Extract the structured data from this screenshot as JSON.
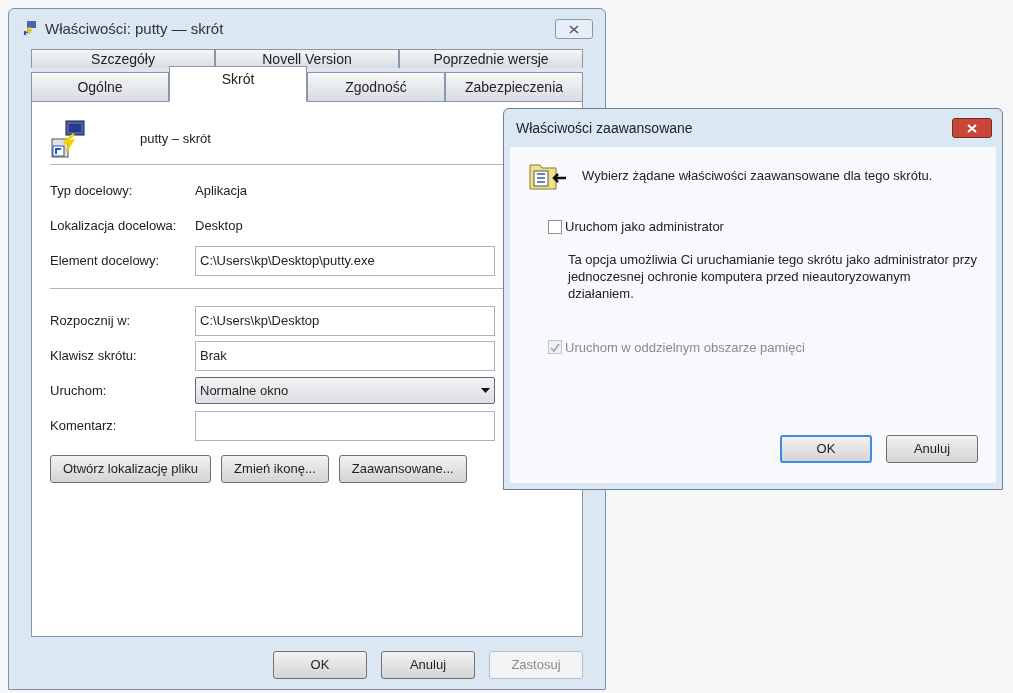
{
  "main_window": {
    "title": "Właściwości: putty — skrót",
    "tab_rows": [
      [
        {
          "label": "Szczegóły",
          "selected": false
        },
        {
          "label": "Novell Version",
          "selected": false
        },
        {
          "label": "Poprzednie wersje",
          "selected": false
        }
      ],
      [
        {
          "label": "Ogólne",
          "selected": false
        },
        {
          "label": "Skrót",
          "selected": true
        },
        {
          "label": "Zgodność",
          "selected": false
        },
        {
          "label": "Zabezpieczenia",
          "selected": false
        }
      ]
    ],
    "shortcut_name": "putty – skrót",
    "groups": [
      [
        {
          "kind": "static",
          "label": "Typ docelowy:",
          "value": "Aplikacja"
        },
        {
          "kind": "static",
          "label": "Lokalizacja docelowa:",
          "value": "Desktop"
        },
        {
          "kind": "input",
          "label": "Element docelowy:",
          "value": "C:\\Users\\kp\\Desktop\\putty.exe"
        }
      ],
      [
        {
          "kind": "input",
          "label": "Rozpocznij w:",
          "value": "C:\\Users\\kp\\Desktop"
        },
        {
          "kind": "input",
          "label": "Klawisz skrótu:",
          "value": "Brak"
        },
        {
          "kind": "dropdown",
          "label": "Uruchom:",
          "value": "Normalne okno"
        },
        {
          "kind": "input",
          "label": "Komentarz:"
        }
      ]
    ],
    "panel_buttons": [
      "Otwórz lokalizację pliku",
      "Zmień ikonę...",
      "Zaawansowane..."
    ],
    "footer_buttons": [
      {
        "label": "OK",
        "disabled": false
      },
      {
        "label": "Anuluj",
        "disabled": false
      },
      {
        "label": "Zastosuj",
        "disabled": true
      }
    ]
  },
  "advanced_dialog": {
    "title": "Właściwości zaawansowane",
    "header": "Wybierz żądane właściwości zaawansowane dla tego skrótu.",
    "options": [
      {
        "label": "Uruchom jako administrator",
        "checked": false,
        "disabled": false,
        "description": "Ta opcja umożliwia Ci uruchamianie tego skrótu jako administrator przy jednoczesnej ochronie komputera przed nieautoryzowanym działaniem."
      },
      {
        "label": "Uruchom w oddzielnym obszarze pamięci",
        "checked": true,
        "disabled": true
      }
    ],
    "buttons": [
      {
        "label": "OK",
        "default": true
      },
      {
        "label": "Anuluj",
        "default": false
      }
    ]
  }
}
